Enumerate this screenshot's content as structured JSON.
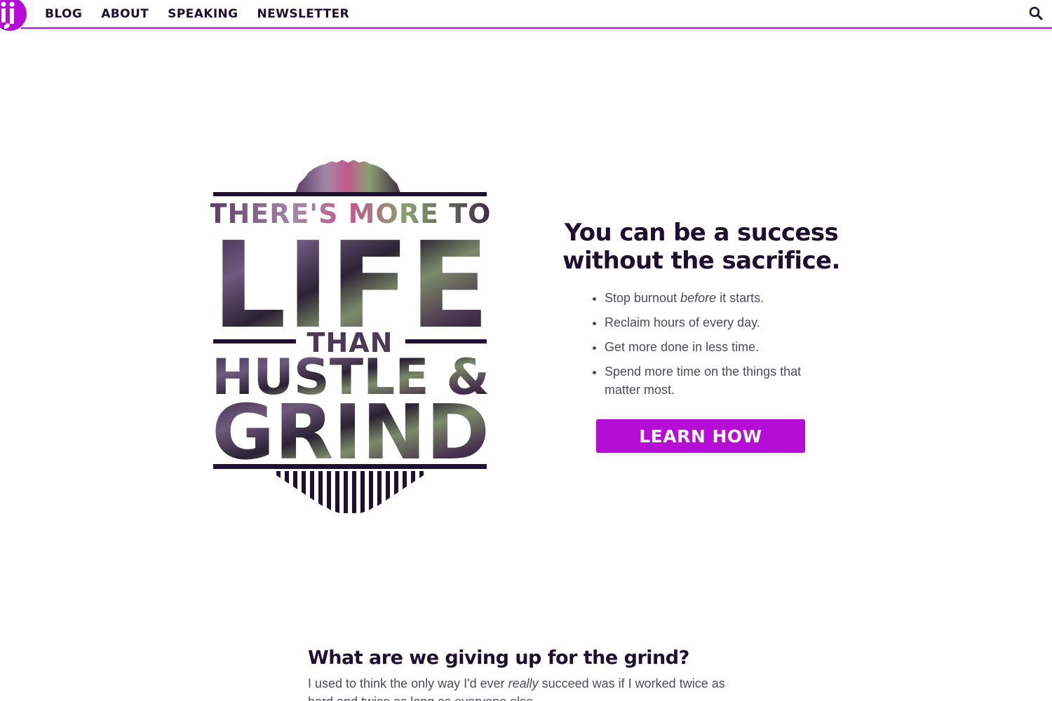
{
  "colors": {
    "accent": "#b60dd6",
    "text_dark": "#1e1030",
    "text_body": "#4b4b5a"
  },
  "header": {
    "logo_icon": "ij-logo-icon",
    "nav": [
      {
        "label": "BLOG"
      },
      {
        "label": "ABOUT"
      },
      {
        "label": "SPEAKING"
      },
      {
        "label": "NEWSLETTER"
      }
    ],
    "search_icon": "search-icon"
  },
  "hero": {
    "badge": {
      "line1": "THERE'S MORE TO",
      "line2": "LIFE",
      "line3": "THAN",
      "line4": "HUSTLE &",
      "line5": "GRIND"
    },
    "title_line1": "You can be a success",
    "title_line2": "without the sacrifice.",
    "bullets": [
      {
        "pre": "Stop burnout ",
        "em": "before",
        "post": " it starts."
      },
      {
        "text": "Reclaim hours of every day."
      },
      {
        "text": "Get more done in less time."
      },
      {
        "text": "Spend more time on the things that matter most."
      }
    ],
    "cta_label": "LEARN HOW"
  },
  "section": {
    "heading": "What are we giving up for the grind?",
    "para_pre": "I used to think the only way I'd ever ",
    "para_em": "really",
    "para_post": " succeed was if I worked twice as hard and twice as long as everyone else."
  }
}
